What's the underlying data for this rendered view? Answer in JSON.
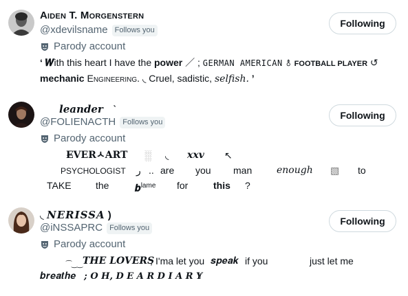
{
  "users": [
    {
      "display_name": "Aiden T. Morgenstern",
      "handle": "@xdevilsname",
      "follows_you": "Follows you",
      "follow_label": "Following",
      "parody_label": "Parody account",
      "bio": {
        "open_quote": "‘",
        "w_letter": "𝑾",
        "text1": "ith this heart I have the",
        "power": "power",
        "slash": "／ ;",
        "german": "GERMAN AMERICAN",
        "gender_sym": "⚨",
        "football": "FOOTBALL PLAYER",
        "loop": "↺",
        "mechanic": "mechanic",
        "engineering": "Engineering.",
        "hook": "◟",
        "cruel": "Cruel, sadistic,",
        "selfish": "selfish.",
        "close_quote": "’"
      }
    },
    {
      "display_name": "leander",
      "name_mark": "ˋ",
      "handle": "@FOLIENACTH",
      "follows_you": "Follows you",
      "follow_label": "Following",
      "parody_label": "Parody account",
      "bio": {
        "everheart": "E̶VERㅅART",
        "block": "░",
        "tick": "◟",
        "xxv": "xxv",
        "corner": "↖",
        "psychologist": "PSYCHOLOGIST",
        "hook2": "ر",
        "dots": "..",
        "are": "are",
        "you": "you",
        "man": "man",
        "enough": "enough",
        "box": "▧",
        "to": "to",
        "take": "TAKE",
        "the": "the",
        "blame_b": "𝒃",
        "blame_sup": "lame",
        "for": "for",
        "this": "this",
        "q": "?"
      }
    },
    {
      "display_name": "NERISSA",
      "name_prefix": "◟",
      "name_suffix": ")",
      "handle": "@iNSSAPRC",
      "follows_you": "Follows you",
      "follow_label": "Following",
      "parody_label": "Parody account",
      "bio": {
        "wave": "⁀‿‿",
        "lovers": "THE LOVERS",
        "semi": ";",
        "imma": "I'ma let you",
        "speak": "𝒔𝒑𝒆𝒂𝒌",
        "ifyou": "if you",
        "just": "just let me",
        "breathe": "𝒃𝒓𝒆𝒂𝒕𝒉𝒆",
        "oh": "; O H, D E A R D I A R Y",
        "excl": "!"
      }
    }
  ],
  "colors": {
    "text": "#0f1419",
    "muted": "#536471",
    "border": "#cfd9de",
    "badge_bg": "#eff3f4"
  },
  "icons": [
    "shield-parody-icon"
  ]
}
